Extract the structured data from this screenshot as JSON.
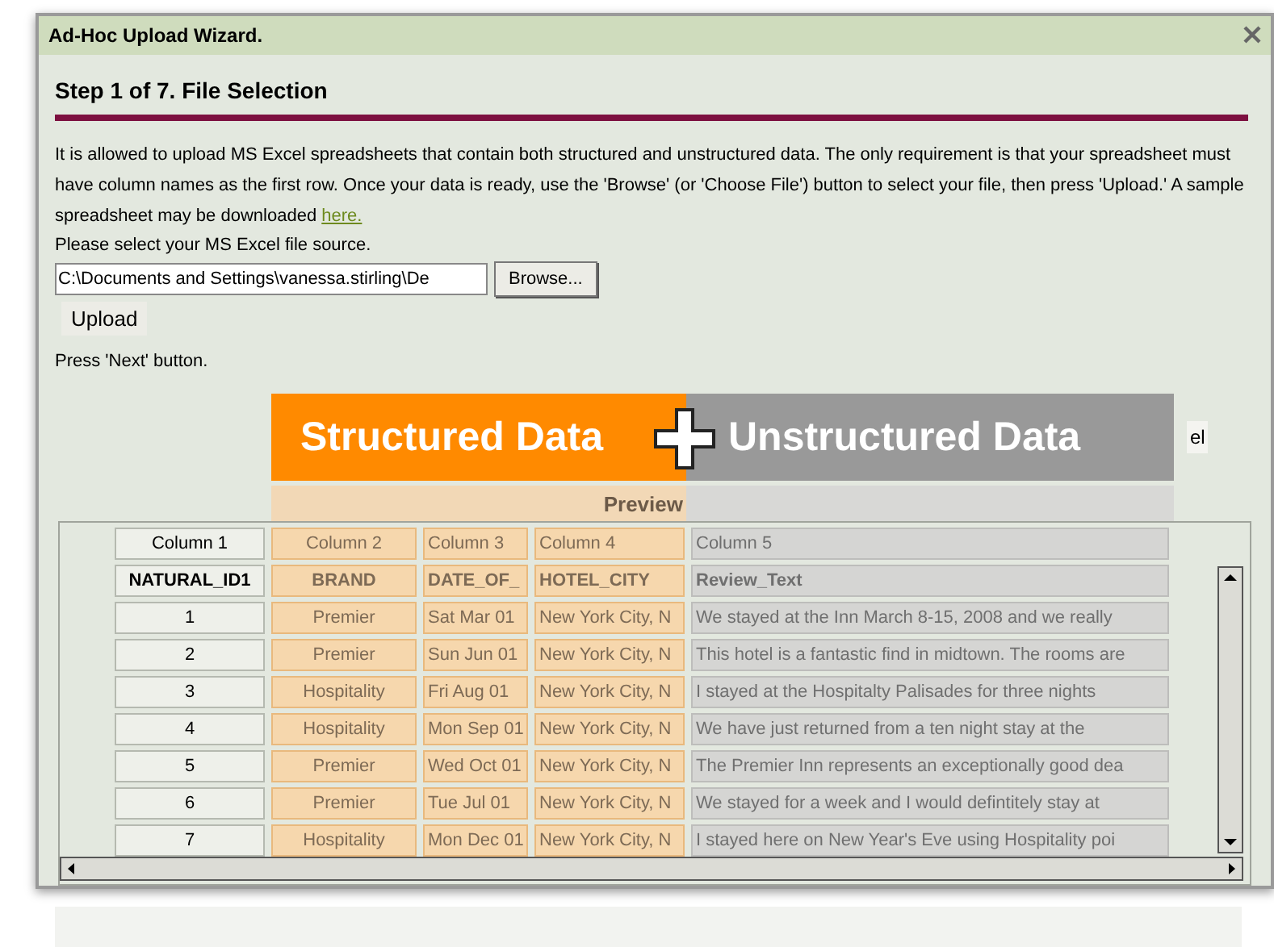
{
  "window": {
    "title": "Ad-Hoc Upload Wizard."
  },
  "step": {
    "title": "Step 1 of 7. File Selection"
  },
  "intro": {
    "text": "It is allowed to upload MS Excel spreadsheets that contain both structured and unstructured data. The only requirement is that your spreadsheet must have column names as the first row. Once your data is ready, use the 'Browse' (or 'Choose File') button to select your file, then press 'Upload.' A sample spreadsheet may be downloaded",
    "link": "here."
  },
  "file_prompt": "Please select your MS Excel file source.",
  "file_field": {
    "value": "C:\\Documents and Settings\\vanessa.stirling\\De"
  },
  "browse_button": "Browse...",
  "upload_button": "Upload",
  "next_hint": "Press 'Next' button.",
  "banner": {
    "structured": "Structured Data",
    "unstructured": "Unstructured Data"
  },
  "partial_button": "el",
  "preview": {
    "title": "Preview",
    "columns": [
      "Column 1",
      "Column 2",
      "Column 3",
      "Column 4",
      "Column 5"
    ],
    "field_names": [
      "NATURAL_ID1",
      "BRAND",
      "DATE_OF_",
      "HOTEL_CITY",
      "Review_Text"
    ],
    "rows": [
      [
        "1",
        "Premier",
        "Sat Mar 01",
        "New York City, N",
        "We stayed at the Inn March 8-15, 2008 and we really"
      ],
      [
        "2",
        "Premier",
        "Sun Jun 01",
        "New York City, N",
        "This hotel is a fantastic find in midtown. The rooms are"
      ],
      [
        "3",
        "Hospitality",
        "Fri Aug 01",
        "New York City, N",
        "I stayed at the Hospitalty Palisades for three nights"
      ],
      [
        "4",
        "Hospitality",
        "Mon Sep 01",
        "New York City, N",
        "We have just returned from a ten night stay at the"
      ],
      [
        "5",
        "Premier",
        "Wed Oct 01",
        "New York City, N",
        "The Premier Inn represents an exceptionally good dea"
      ],
      [
        "6",
        "Premier",
        "Tue Jul 01",
        "New York City, N",
        "We stayed for a week and I would defintitely stay at"
      ],
      [
        "7",
        "Hospitality",
        "Mon Dec 01",
        "New York City, N",
        "I stayed here on New Year's Eve using Hospitality poi"
      ]
    ]
  }
}
